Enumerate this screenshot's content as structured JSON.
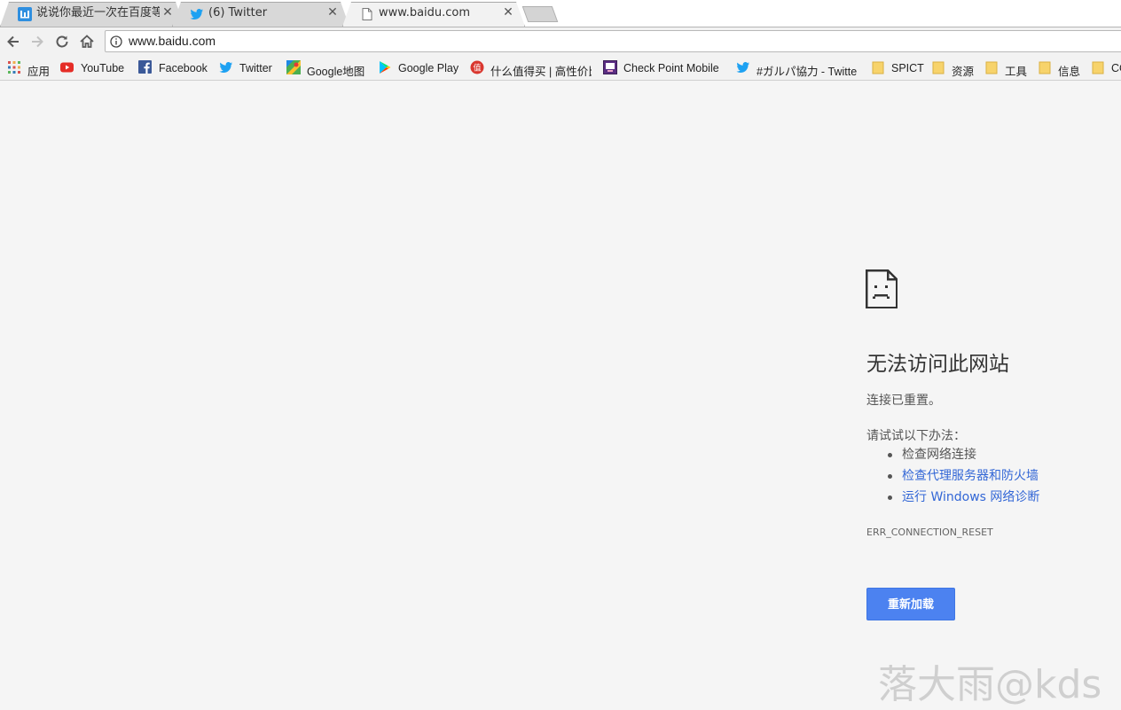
{
  "tabs": [
    {
      "title": "说说你最近一次在百度等",
      "favicon": "baidu-zhidao-icon",
      "active": false
    },
    {
      "title": "(6) Twitter",
      "favicon": "twitter-icon",
      "active": false
    },
    {
      "title": "www.baidu.com",
      "favicon": "page-icon",
      "active": true
    }
  ],
  "omnibox": {
    "url": "www.baidu.com"
  },
  "bookmarks": [
    {
      "label": "应用",
      "icon": "apps-grid-icon"
    },
    {
      "label": "YouTube",
      "icon": "youtube-icon"
    },
    {
      "label": "Facebook",
      "icon": "facebook-icon"
    },
    {
      "label": "Twitter",
      "icon": "twitter-icon"
    },
    {
      "label": "Google地图",
      "icon": "google-maps-icon"
    },
    {
      "label": "Google Play",
      "icon": "google-play-icon"
    },
    {
      "label": "什么值得买 | 高性价比",
      "icon": "smzdm-icon"
    },
    {
      "label": "Check Point Mobile",
      "icon": "checkpoint-icon"
    },
    {
      "label": "#ガルパ協力 - Twitte",
      "icon": "twitter-icon"
    },
    {
      "label": "SPICT",
      "icon": "folder-icon"
    },
    {
      "label": "资源",
      "icon": "folder-icon"
    },
    {
      "label": "工具",
      "icon": "folder-icon"
    },
    {
      "label": "信息",
      "icon": "folder-icon"
    },
    {
      "label": "CO",
      "icon": "folder-icon"
    }
  ],
  "error": {
    "title": "无法访问此网站",
    "description": "连接已重置。",
    "try_heading": "请试试以下办法：",
    "suggestions": [
      {
        "text": "检查网络连接",
        "link": false
      },
      {
        "text": "检查代理服务器和防火墙",
        "link": true
      },
      {
        "text": "运行 Windows 网络诊断",
        "link": true
      }
    ],
    "code": "ERR_CONNECTION_RESET",
    "reload_label": "重新加载"
  },
  "watermark": "落大雨@kds",
  "colors": {
    "accent": "#4c82f0",
    "link": "#3367d6",
    "background": "#f5f5f5"
  }
}
